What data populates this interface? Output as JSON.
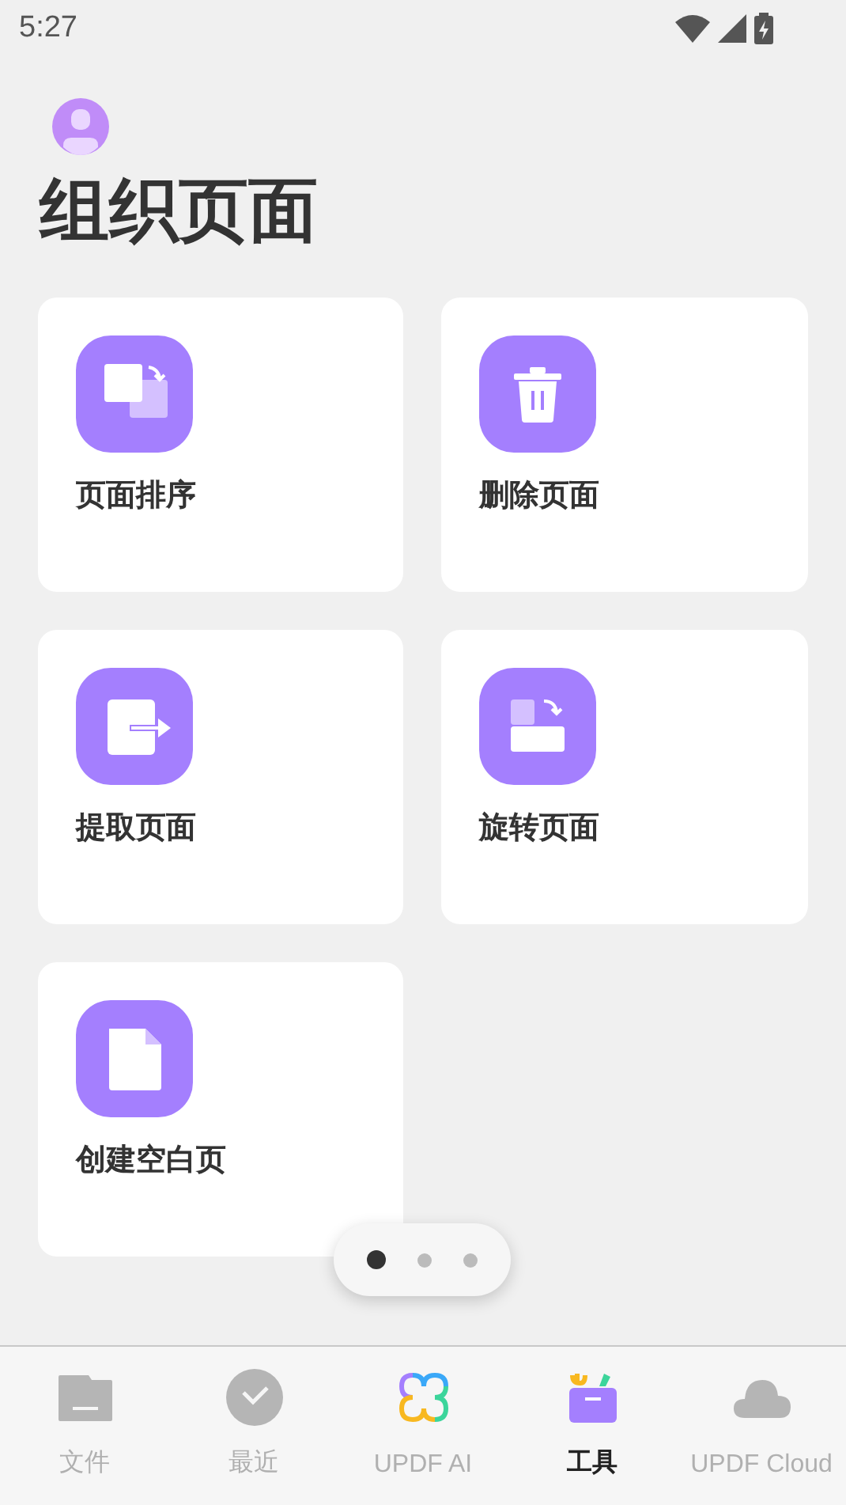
{
  "status_bar": {
    "time": "5:27"
  },
  "title": "组织页面",
  "tools": [
    {
      "kind": "reorder",
      "label": "页面排序"
    },
    {
      "kind": "delete",
      "label": "删除页面"
    },
    {
      "kind": "extract",
      "label": "提取页面"
    },
    {
      "kind": "rotate",
      "label": "旋转页面"
    },
    {
      "kind": "blank",
      "label": "创建空白页"
    }
  ],
  "pager": [
    {
      "selected": true
    },
    {
      "selected": false
    },
    {
      "selected": false
    }
  ],
  "tabs": [
    {
      "kind": "files",
      "label": "文件",
      "selected": false
    },
    {
      "kind": "recent",
      "label": "最近",
      "selected": false
    },
    {
      "kind": "ai",
      "label": "UPDF AI",
      "selected": false
    },
    {
      "kind": "tools",
      "label": "工具",
      "selected": true
    },
    {
      "kind": "cloud",
      "label": "UPDF Cloud",
      "selected": false
    }
  ]
}
